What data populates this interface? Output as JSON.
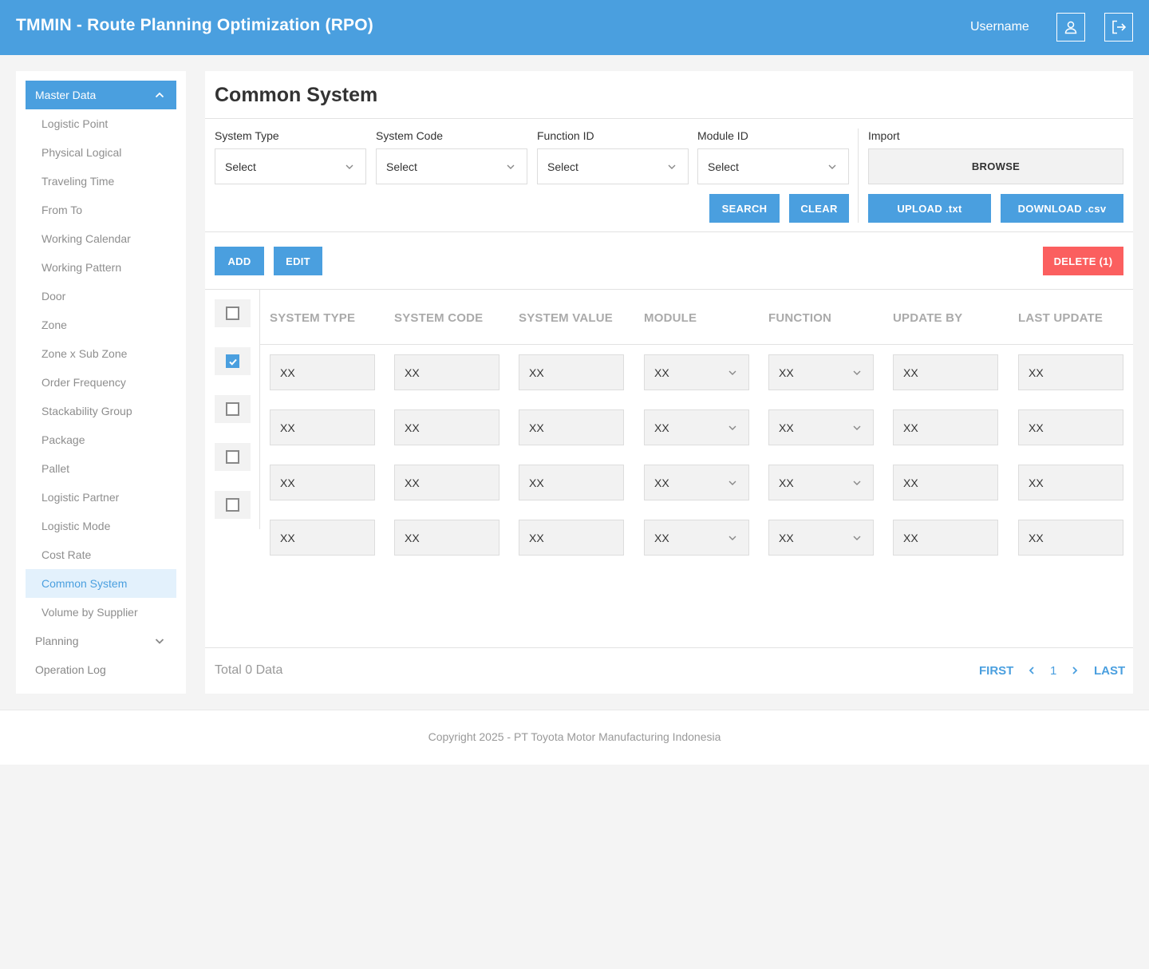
{
  "header": {
    "title": "TMMIN - Route Planning Optimization (RPO)",
    "username": "Username",
    "brand_color": "#4a9fdf"
  },
  "sidebar": {
    "master_data_label": "Master Data",
    "items": [
      "Logistic Point",
      "Physical Logical",
      "Traveling Time",
      "From To",
      "Working Calendar",
      "Working Pattern",
      "Door",
      "Zone",
      "Zone x Sub Zone",
      "Order Frequency",
      "Stackability Group",
      "Package",
      "Pallet",
      "Logistic Partner",
      "Logistic Mode",
      "Cost Rate",
      "Common System",
      "Volume by Supplier"
    ],
    "active_item": "Common System",
    "planning_label": "Planning",
    "operation_log_label": "Operation Log"
  },
  "page": {
    "title": "Common System"
  },
  "filters": {
    "system_type": {
      "label": "System Type",
      "value": "Select"
    },
    "system_code": {
      "label": "System Code",
      "value": "Select"
    },
    "function_id": {
      "label": "Function ID",
      "value": "Select"
    },
    "module_id": {
      "label": "Module ID",
      "value": "Select"
    },
    "search_label": "SEARCH",
    "clear_label": "CLEAR"
  },
  "import": {
    "label": "Import",
    "browse_label": "BROWSE",
    "upload_label": "UPLOAD .txt",
    "download_label": "DOWNLOAD .csv"
  },
  "actions": {
    "add_label": "ADD",
    "edit_label": "EDIT",
    "delete_label": "DELETE (1)",
    "delete_color": "#fb5f5f"
  },
  "table": {
    "columns": [
      "SYSTEM TYPE",
      "SYSTEM CODE",
      "SYSTEM VALUE",
      "MODULE",
      "FUNCTION",
      "UPDATE BY",
      "LAST UPDATE"
    ],
    "rows": [
      {
        "checked": true,
        "cells": [
          "XX",
          "XX",
          "XX",
          "XX",
          "XX",
          "XX",
          "XX"
        ]
      },
      {
        "checked": false,
        "cells": [
          "XX",
          "XX",
          "XX",
          "XX",
          "XX",
          "XX",
          "XX"
        ]
      },
      {
        "checked": false,
        "cells": [
          "XX",
          "XX",
          "XX",
          "XX",
          "XX",
          "XX",
          "XX"
        ]
      },
      {
        "checked": false,
        "cells": [
          "XX",
          "XX",
          "XX",
          "XX",
          "XX",
          "XX",
          "XX"
        ]
      }
    ],
    "select_all_checked": false
  },
  "pagination": {
    "total_text": "Total 0 Data",
    "first_label": "FIRST",
    "current_page": "1",
    "last_label": "LAST"
  },
  "footer": {
    "copyright": "Copyright 2025 - PT Toyota Motor Manufacturing Indonesia"
  }
}
